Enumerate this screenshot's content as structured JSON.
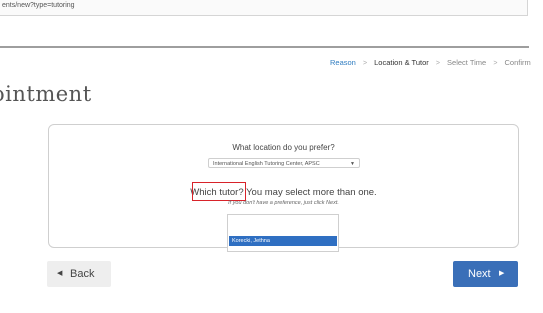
{
  "browser": {
    "url": "ents/new?type=tutoring"
  },
  "steps": {
    "items": [
      "Reason",
      "Location & Tutor",
      "Select Time",
      "Confirm"
    ],
    "separator": ">"
  },
  "page": {
    "title": "ointment"
  },
  "form": {
    "location_question": "What location do you prefer?",
    "location_selected": "International English Tutoring Center, APSC",
    "tutor_question_highlight": "Which tutor?",
    "tutor_question_rest": " You may select more than one.",
    "tutor_hint": "If you don't have a preference, just click Next.",
    "tutor_option": "Korecki, Jethna"
  },
  "nav": {
    "back_label": "Back",
    "next_label": "Next"
  },
  "icons": {
    "back": "triangle-left-icon",
    "next": "triangle-right-icon",
    "dropdown": "caret-down-icon"
  },
  "colors": {
    "accent": "#3a6fb8",
    "link": "#2f7cc0",
    "highlight_box": "#d8232a",
    "selected_option": "#2f6fc2"
  }
}
